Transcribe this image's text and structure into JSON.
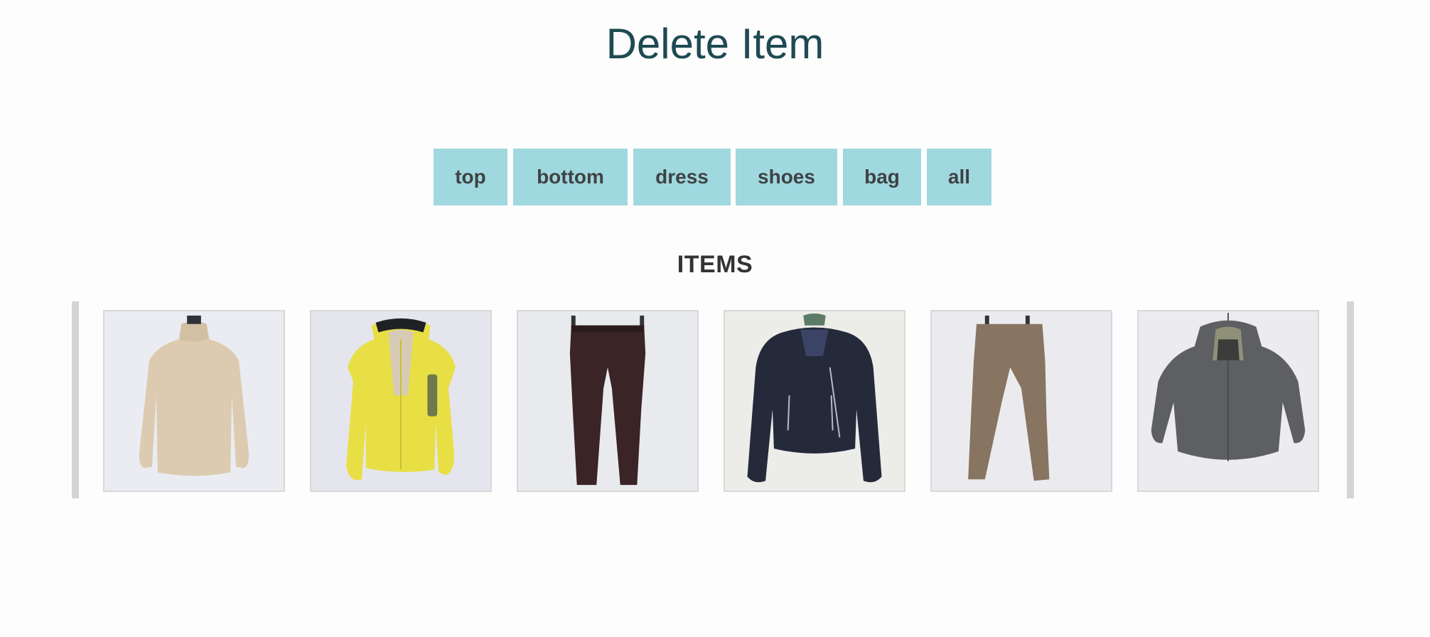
{
  "page": {
    "title": "Delete Item"
  },
  "filters": [
    {
      "label": "top"
    },
    {
      "label": "bottom"
    },
    {
      "label": "dress"
    },
    {
      "label": "shoes"
    },
    {
      "label": "bag"
    },
    {
      "label": "all"
    }
  ],
  "items_section": {
    "heading": "ITEMS"
  },
  "items": [
    {
      "icon": "turtleneck-sweater-icon",
      "color": "#dccbb0"
    },
    {
      "icon": "yellow-rain-jacket-icon",
      "color": "#e8df45"
    },
    {
      "icon": "dark-jeans-icon",
      "color": "#3a2426"
    },
    {
      "icon": "navy-moto-jacket-icon",
      "color": "#252a3b"
    },
    {
      "icon": "khaki-pants-icon",
      "color": "#877561"
    },
    {
      "icon": "gray-hooded-jacket-icon",
      "color": "#5e5f62"
    }
  ],
  "colors": {
    "title": "#1e4a52",
    "filter_bg": "#a0d8e0",
    "filter_text": "#3f4243",
    "background": "#fdfdfd"
  }
}
